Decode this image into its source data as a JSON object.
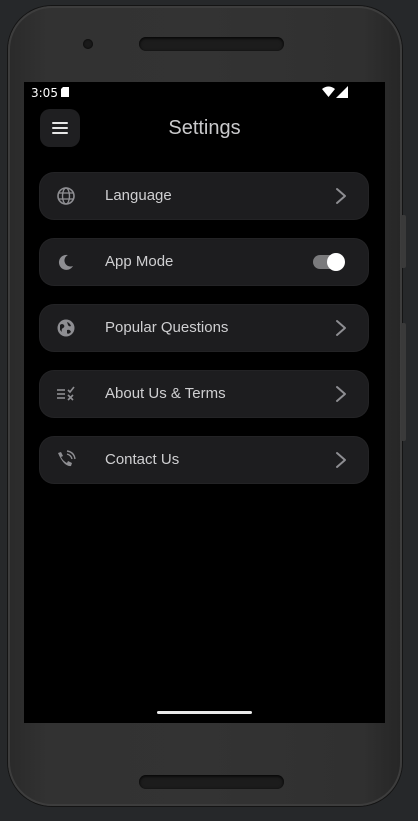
{
  "status_bar": {
    "time": "3:05"
  },
  "header": {
    "title": "Settings"
  },
  "settings": [
    {
      "label": "Language",
      "icon": "globe-icon",
      "control": "chevron"
    },
    {
      "label": "App Mode",
      "icon": "moon-icon",
      "control": "toggle",
      "toggle_on": true
    },
    {
      "label": "Popular Questions",
      "icon": "earth-icon",
      "control": "chevron"
    },
    {
      "label": "About Us & Terms",
      "icon": "list-check-icon",
      "control": "chevron"
    },
    {
      "label": "Contact Us",
      "icon": "phone-call-icon",
      "control": "chevron"
    }
  ],
  "colors": {
    "screen_bg": "#000000",
    "row_bg": "#1d1d1f",
    "text": "#cfcfd1",
    "icon": "#8e8e92",
    "toggle_track": "#7a7a7c",
    "toggle_knob": "#ffffff"
  }
}
